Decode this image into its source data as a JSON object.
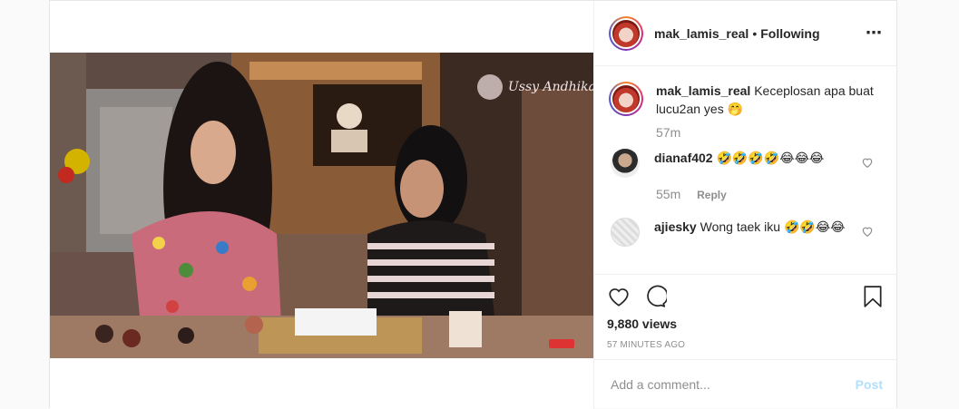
{
  "post": {
    "username": "mak_lamis_real",
    "separator": "•",
    "follow_status": "Following",
    "more_icon": "⋯",
    "caption": {
      "username": "mak_lamis_real",
      "text": "Keceplosan apa buat lucu2an yes 🤭",
      "time": "57m"
    },
    "comments": [
      {
        "username": "dianaf402",
        "text": "🤣🤣🤣🤣😂😂😂",
        "time": "55m",
        "reply": "Reply"
      },
      {
        "username": "ajiesky",
        "text": "Wong taek iku 🤣🤣😂😂"
      }
    ],
    "views": "9,880 views",
    "time_ago": "57 MINUTES AGO",
    "add_comment": {
      "placeholder": "Add a comment...",
      "post_label": "Post"
    },
    "video_watermark": "Ussy Andhika",
    "colors": {
      "accent": "#3897f0",
      "post_disabled": "#b2dffc",
      "muted": "#8e8e8e",
      "text": "#262626"
    }
  }
}
